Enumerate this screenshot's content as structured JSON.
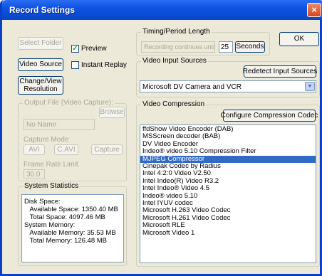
{
  "window": {
    "title": "Record Settings",
    "close_glyph": "×"
  },
  "buttons": {
    "select_folder": "Select Folder",
    "video_source": "Video Source",
    "change_preview": "Change/View\nResolution",
    "ok": "OK",
    "seconds": "Seconds",
    "redetect": "Redetect Input Sources",
    "configure": "Configure Compression Codec",
    "browse": "Browse"
  },
  "checks": {
    "preview": {
      "label": "Preview",
      "checked": true
    },
    "instant_replay": {
      "label": "Instant Replay",
      "checked": false
    }
  },
  "recording_length": {
    "label": "Timing/Period Length",
    "value": "Recording continues until stop",
    "spin": "25"
  },
  "video_input": {
    "label": "Video Input Sources",
    "selected": "Microsoft DV Camera and VCR"
  },
  "output_file": {
    "label": "Output File (Video Capture):",
    "value": "No Name",
    "sub_label": "Capture Mode",
    "mode_a": "AVI",
    "mode_b": "C.AVI",
    "mode_c": "Capture",
    "limit_label": "Frame Rate Limit",
    "limit_value": "30.0"
  },
  "video_compression": {
    "label": "Video Compression",
    "items": [
      "ffdShow Video Encoder (DAB)",
      "MSScreen decoder (BAB)",
      "DV Video Encoder",
      "Indeo® video 5.10 Compression Filter",
      "MJPEG Compressor",
      "Cinepak Codec by Radius",
      "Intel 4:2:0 Video V2.50",
      "Intel Indeo(R) Video R3.2",
      "Intel Indeo® Video 4.5",
      "Indeo® video 5.10",
      "Intel IYUV codec",
      "Microsoft H.263 Video Codec",
      "Microsoft H.261 Video Codec",
      "Microsoft RLE",
      "Microsoft Video 1"
    ],
    "selected_index": 4
  },
  "system_statistics": {
    "label": "System Statistics",
    "lines": [
      "Disk Space:",
      "   Available Space: 1350.40 MB",
      "   Total Space: 4097.46 MB",
      "System Memory:",
      "   Available Memory: 35.53 MB",
      "   Total Memory: 126.48 MB"
    ]
  }
}
